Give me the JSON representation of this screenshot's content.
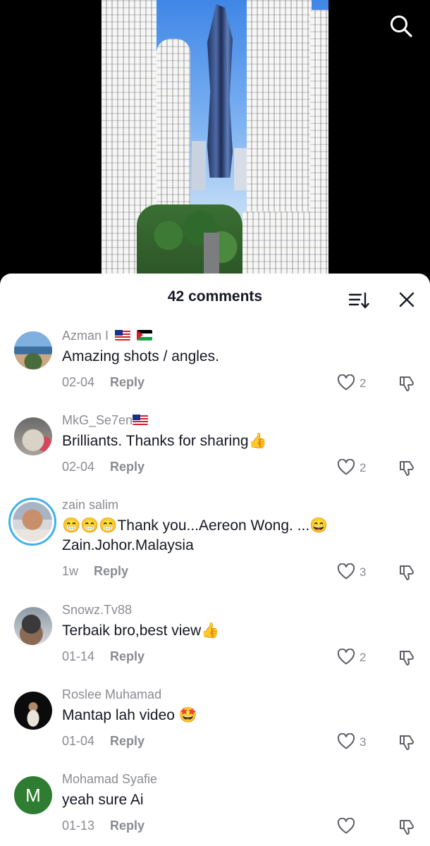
{
  "header": {
    "comment_count": "42 comments"
  },
  "icons": {
    "search": "search-icon",
    "sort": "sort-icon",
    "close": "close-icon",
    "like": "heart-icon",
    "dislike": "thumbs-down-icon"
  },
  "comments": [
    {
      "username": "Azman I",
      "flags": [
        "malaysia-flag",
        "palestine-flag"
      ],
      "text": "Amazing shots / angles.",
      "date": "02-04",
      "reply_label": "Reply",
      "likes": "2"
    },
    {
      "username": "MkG_Se7en",
      "flags": [
        "malaysia-flag"
      ],
      "text": "Brilliants. Thanks for sharing👍",
      "date": "02-04",
      "reply_label": "Reply",
      "likes": "2"
    },
    {
      "username": "zain salim",
      "text_line1": "😁😁😁Thank you...Aereon Wong. ...😄",
      "text_line2": "Zain.Johor.Malaysia",
      "date": "1w",
      "reply_label": "Reply",
      "likes": "3"
    },
    {
      "username": "Snowz.Tv88",
      "text": "Terbaik bro,best view👍",
      "date": "01-14",
      "reply_label": "Reply",
      "likes": "2"
    },
    {
      "username": "Roslee Muhamad",
      "text": "Mantap lah video 🤩",
      "date": "01-04",
      "reply_label": "Reply",
      "likes": "3"
    },
    {
      "username": "Mohamad Syafie",
      "avatar_initial": "M",
      "text": "yeah sure Ai",
      "date": "01-13",
      "reply_label": "Reply",
      "likes": ""
    }
  ],
  "colors": {
    "text": "#161823",
    "muted": "#8a8b91",
    "avatar_green": "#2e7d32",
    "story_ring": "#3fb2e8"
  }
}
